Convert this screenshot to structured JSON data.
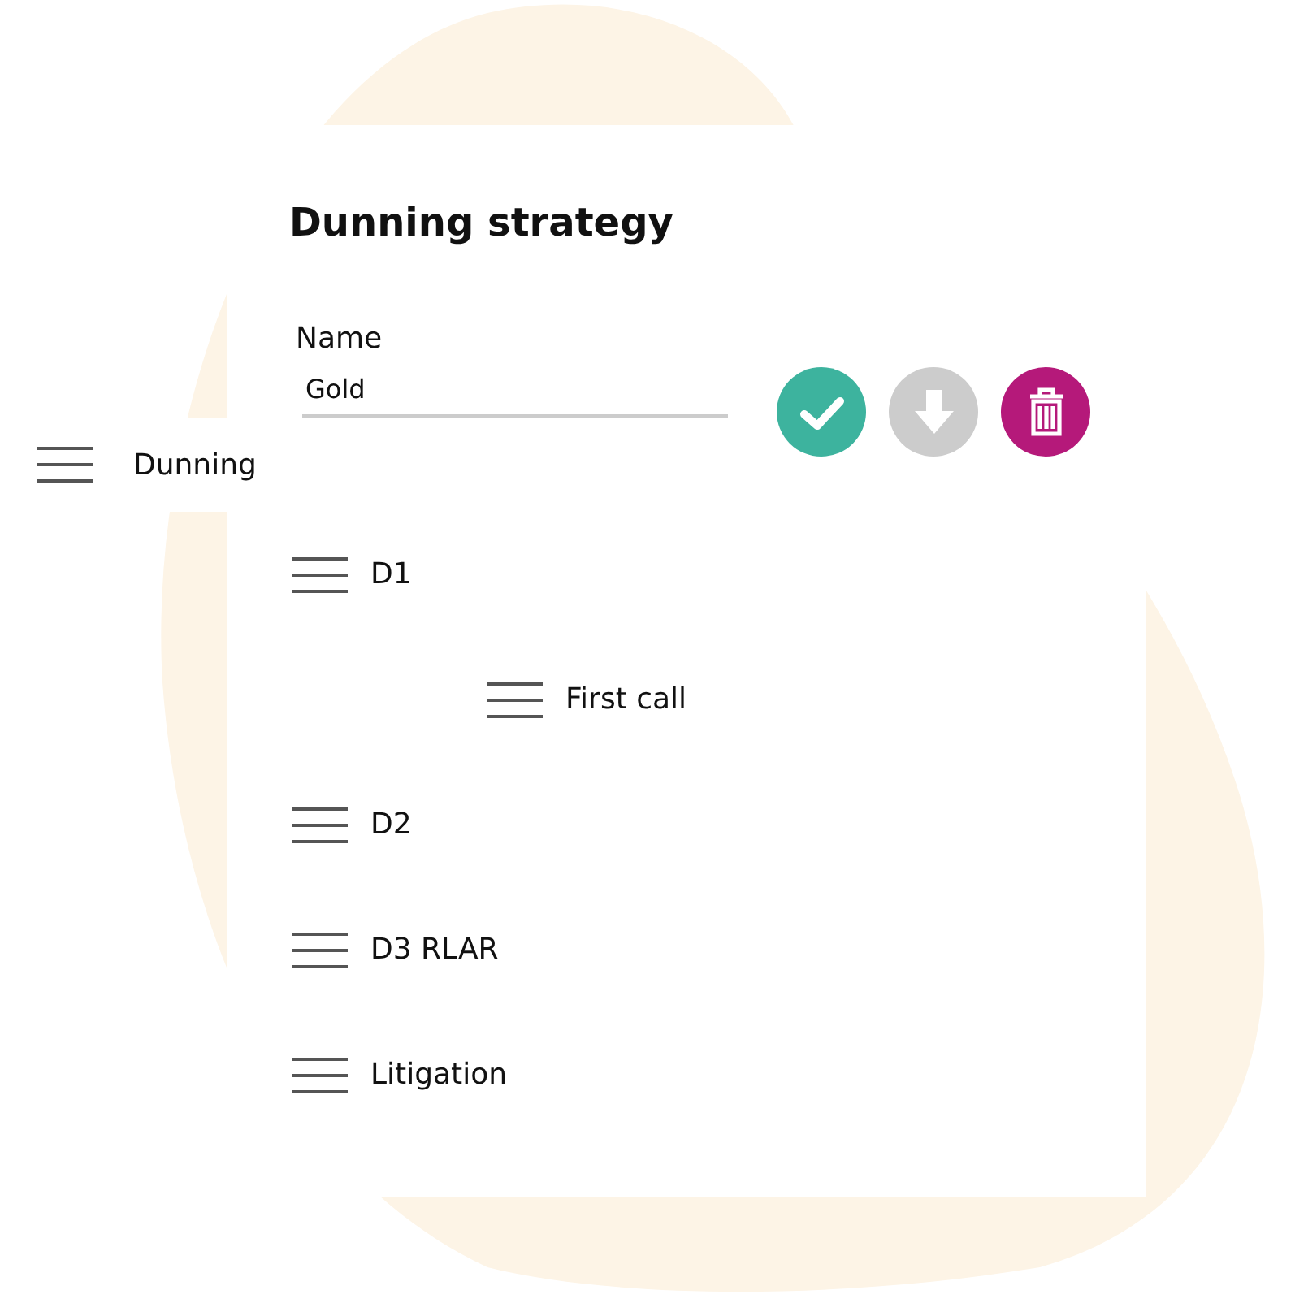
{
  "form": {
    "title": "Dunning strategy",
    "name_label": "Name",
    "name_value": "Gold"
  },
  "actions": [
    {
      "kind": "confirm"
    },
    {
      "kind": "download",
      "disabled": true
    },
    {
      "kind": "delete"
    }
  ],
  "tree": [
    {
      "label": "Dunning",
      "children": [
        {
          "label": "D1",
          "children": [
            {
              "label": "First call"
            }
          ]
        },
        {
          "label": "D2"
        },
        {
          "label": "D3 RLAR"
        },
        {
          "label": "Litigation"
        }
      ]
    }
  ]
}
